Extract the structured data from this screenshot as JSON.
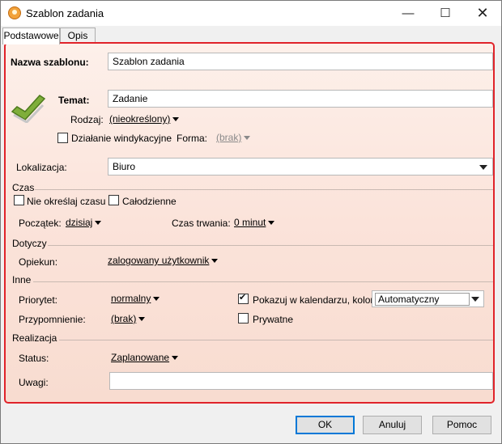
{
  "window": {
    "title": "Szablon zadania"
  },
  "tabs": [
    {
      "label": "Podstawowe",
      "active": true
    },
    {
      "label": "Opis",
      "active": false
    }
  ],
  "form": {
    "name_label": "Nazwa szablonu:",
    "name_value": "Szablon zadania",
    "subject_label": "Temat:",
    "subject_value": "Zadanie",
    "type_label": "Rodzaj:",
    "type_value": "(nieokreślony)",
    "debt_label": "Działanie windykacyjne",
    "debt_checked": false,
    "form_label": "Forma:",
    "form_value": "(brak)",
    "location_label": "Lokalizacja:",
    "location_value": "Biuro"
  },
  "time": {
    "section": "Czas",
    "no_time_label": "Nie określaj czasu",
    "no_time_checked": false,
    "all_day_label": "Całodzienne",
    "all_day_checked": false,
    "start_label": "Początek:",
    "start_value": "dzisiaj",
    "duration_label": "Czas trwania:",
    "duration_value": "0 minut"
  },
  "concerns": {
    "section": "Dotyczy",
    "guardian_label": "Opiekun:",
    "guardian_value": "zalogowany użytkownik"
  },
  "other": {
    "section": "Inne",
    "priority_label": "Priorytet:",
    "priority_value": "normalny",
    "reminder_label": "Przypomnienie:",
    "reminder_value": "(brak)",
    "calendar_label": "Pokazuj w kalendarzu, kolor:",
    "calendar_checked": true,
    "color_value": "Automatyczny",
    "private_label": "Prywatne",
    "private_checked": false
  },
  "realization": {
    "section": "Realizacja",
    "status_label": "Status:",
    "status_value": "Zaplanowane",
    "notes_label": "Uwagi:",
    "notes_value": ""
  },
  "buttons": {
    "ok": "OK",
    "cancel": "Anuluj",
    "help": "Pomoc"
  },
  "icons": {
    "app": "app-icon",
    "task": "checkmark-icon"
  },
  "colors": {
    "accent_border": "#e0232a",
    "panel_bg": "#fbe3da"
  }
}
